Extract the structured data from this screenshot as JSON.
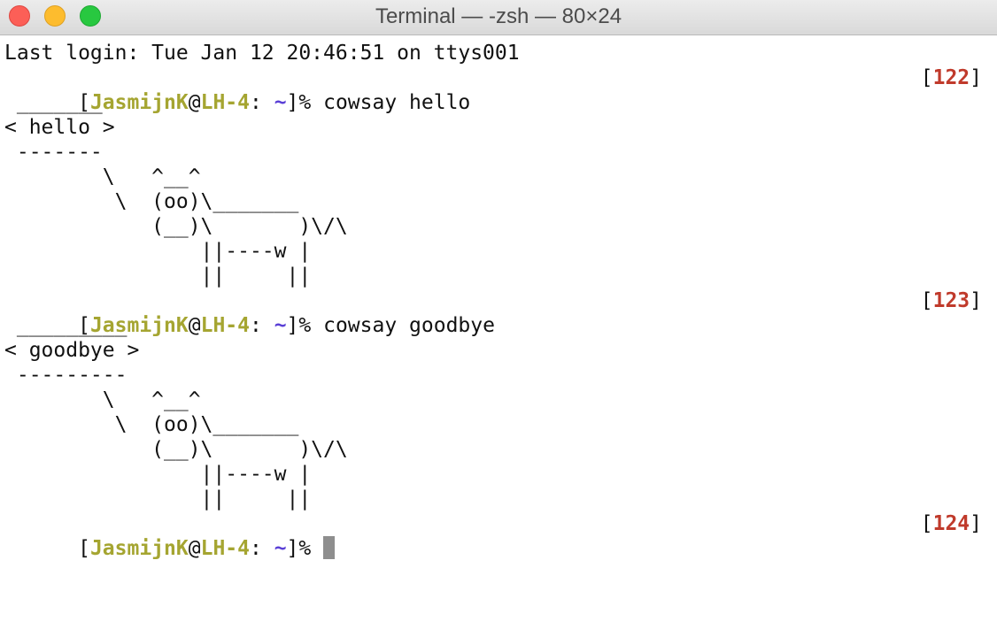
{
  "window": {
    "title": "Terminal — -zsh — 80×24"
  },
  "terminal": {
    "login_line": "Last login: Tue Jan 12 20:46:51 on ttys001",
    "prompt": {
      "open_bracket": "[",
      "user": "JasmijnK",
      "at": "@",
      "host": "LH-4",
      "colon": ": ",
      "dir": "~",
      "close_bracket": "]",
      "symbol": "% "
    },
    "commands": [
      {
        "command": "cowsay hello",
        "counter": "122",
        "output": [
          " _______",
          "< hello >",
          " -------",
          "        \\   ^__^",
          "         \\  (oo)\\_______",
          "            (__)\\       )\\/\\",
          "                ||----w |",
          "                ||     ||"
        ]
      },
      {
        "command": "cowsay goodbye",
        "counter": "123",
        "output": [
          " _________",
          "< goodbye >",
          " ---------",
          "        \\   ^__^",
          "         \\  (oo)\\_______",
          "            (__)\\       )\\/\\",
          "                ||----w |",
          "                ||     ||"
        ]
      }
    ],
    "current_prompt": {
      "counter": "124"
    }
  },
  "colors": {
    "user_host": "#a5a531",
    "directory": "#5a3fd6",
    "counter": "#c03a2b",
    "cursor": "#8e8e8e"
  }
}
